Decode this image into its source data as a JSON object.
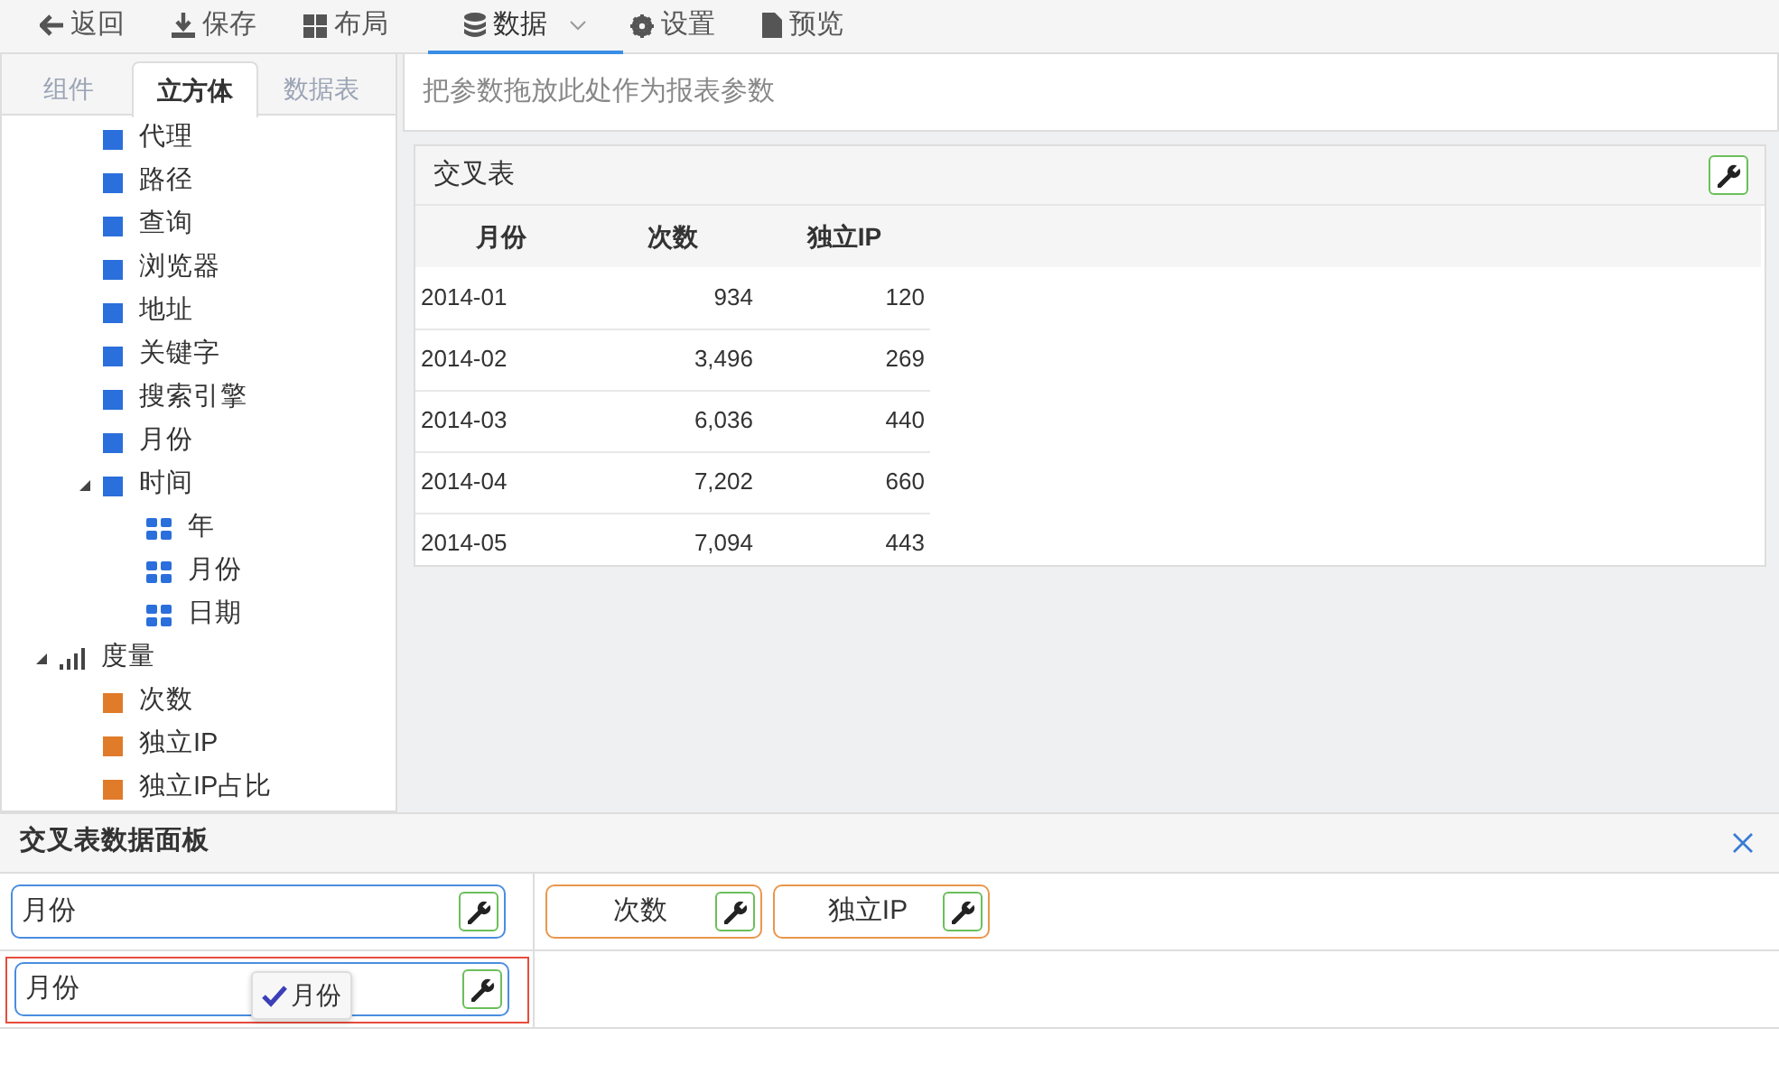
{
  "toolbar": [
    {
      "label": "返回",
      "selected": false
    },
    {
      "label": "保存",
      "selected": false
    },
    {
      "label": "布局",
      "selected": false
    },
    {
      "label": "数据",
      "selected": true,
      "dropdown": true
    },
    {
      "label": "设置",
      "selected": false
    },
    {
      "label": "预览",
      "selected": false
    }
  ],
  "left_tabs": [
    {
      "label": "组件",
      "selected": false
    },
    {
      "label": "立方体",
      "selected": true
    },
    {
      "label": "数据表",
      "selected": false
    }
  ],
  "tree": [
    {
      "children": [
        {
          "label": "代理",
          "kind": "dimension"
        },
        {
          "label": "路径",
          "kind": "dimension"
        },
        {
          "label": "查询",
          "kind": "dimension"
        },
        {
          "label": "浏览器",
          "kind": "dimension"
        },
        {
          "label": "地址",
          "kind": "dimension"
        },
        {
          "label": "关键字",
          "kind": "dimension"
        },
        {
          "label": "搜索引擎",
          "kind": "dimension"
        },
        {
          "label": "月份",
          "kind": "dimension"
        },
        {
          "label": "时间",
          "kind": "dimension",
          "expanded": true,
          "children": [
            {
              "label": "年",
              "kind": "level"
            },
            {
              "label": "月份",
              "kind": "level"
            },
            {
              "label": "日期",
              "kind": "level"
            }
          ]
        }
      ]
    },
    {
      "label": "度量",
      "kind": "measures",
      "expanded": true,
      "children": [
        {
          "label": "次数",
          "kind": "measure"
        },
        {
          "label": "独立IP",
          "kind": "measure"
        },
        {
          "label": "独立IP占比",
          "kind": "measure"
        }
      ]
    }
  ],
  "params_drop_hint": "把参数拖放此处作为报表参数",
  "report": {
    "title": "交叉表",
    "columns": [
      "月份",
      "次数",
      "独立IP"
    ],
    "rows": [
      [
        "2014-01",
        "934",
        "120"
      ],
      [
        "2014-02",
        "3,496",
        "269"
      ],
      [
        "2014-03",
        "6,036",
        "440"
      ],
      [
        "2014-04",
        "7,202",
        "660"
      ],
      [
        "2014-05",
        "7,094",
        "443"
      ]
    ]
  },
  "data_panel": {
    "title": "交叉表数据面板",
    "zones": [
      {
        "highlighted": false,
        "fields": [
          {
            "label": "月份",
            "kind": "dimension"
          }
        ]
      },
      {
        "highlighted": false,
        "fields": [
          {
            "label": "次数",
            "kind": "measure"
          },
          {
            "label": "独立IP",
            "kind": "measure"
          }
        ]
      },
      {
        "highlighted": true,
        "fields": [
          {
            "label": "月份",
            "kind": "dimension"
          }
        ],
        "tooltip": "月份"
      },
      {
        "highlighted": false
      }
    ]
  }
}
